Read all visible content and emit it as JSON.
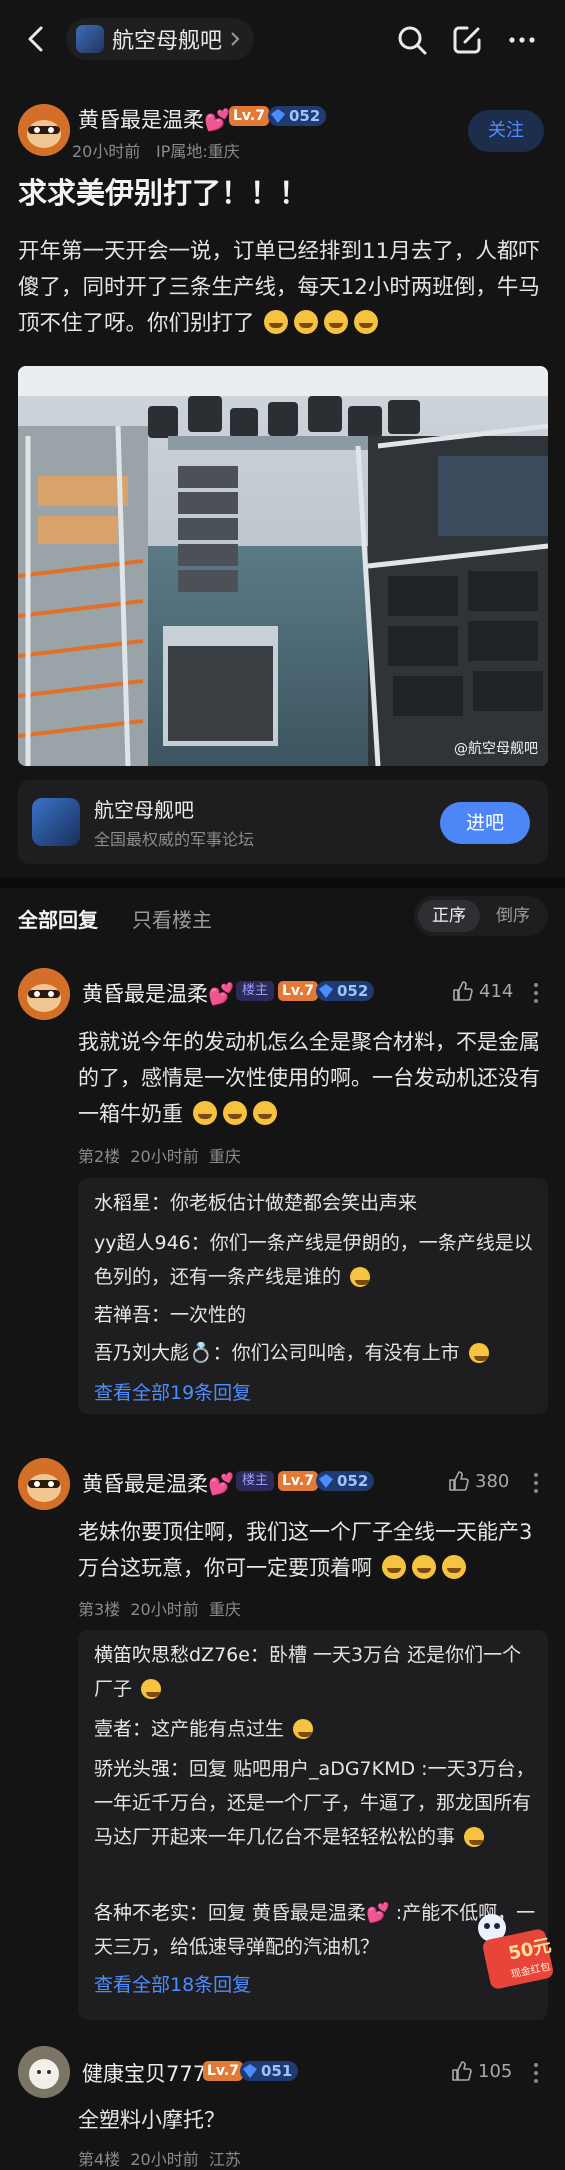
{
  "topbar": {
    "forum_name": "航空母舰吧"
  },
  "post": {
    "author": "黄昏最是温柔",
    "heart": "💕",
    "level": "Lv.7",
    "gem_level": "052",
    "time": "20小时前",
    "ip": "IP属地:重庆",
    "follow_label": "关注",
    "title": "求求美伊别打了！！！",
    "body": "开年第一天开会一说，订单已经排到11月去了，人都吓傻了，同时开了三条生产线，每天12小时两班倒，牛马顶不住了呀。你们别打了",
    "body_emoji_count": 4,
    "photo_watermark": "@航空母舰吧"
  },
  "forum_card": {
    "name": "航空母舰吧",
    "subtitle": "全国最权威的军事论坛",
    "join_label": "进吧"
  },
  "tabs": {
    "all_replies": "全部回复",
    "op_only": "只看楼主",
    "sort_asc": "正序",
    "sort_desc": "倒序"
  },
  "comments": [
    {
      "author": "黄昏最是温柔",
      "heart": "💕",
      "host_badge": "楼主",
      "level": "Lv.7",
      "gem_level": "052",
      "likes": "414",
      "text": "我就说今年的发动机怎么全是聚合材料，不是金属的了，感情是一次性使用的啊。一台发动机还没有一箱牛奶重",
      "floor": "第2楼",
      "time": "20小时前",
      "location": "重庆",
      "replies": [
        {
          "who": "水稻星：",
          "text": "你老板估计做楚都会笑出声来"
        },
        {
          "who": "yy超人946：",
          "text": "你们一条产线是伊朗的，一条产线是以色列的，还有一条产线是谁的"
        },
        {
          "who": "若禅吾：",
          "text": "一次性的"
        },
        {
          "who": "吾乃刘大彪💍：",
          "text": "你们公司叫啥，有没有上市"
        }
      ],
      "view_all": "查看全部19条回复"
    },
    {
      "author": "黄昏最是温柔",
      "heart": "💕",
      "host_badge": "楼主",
      "level": "Lv.7",
      "gem_level": "052",
      "likes": "380",
      "text": "老妹你要顶住啊，我们这一个厂子全线一天能产3万台这玩意，你可一定要顶着啊",
      "floor": "第3楼",
      "time": "20小时前",
      "location": "重庆",
      "replies": [
        {
          "who": "横笛吹思愁dZ76e：",
          "text": "卧槽 一天3万台 还是你们一个厂子"
        },
        {
          "who": "壹者：",
          "text": "这产能有点过生"
        },
        {
          "who": "骄光头强：",
          "text": "回复 贴吧用户_aDG7KMD :一天3万台，一年近千万台，还是一个厂子，牛逼了，那龙国所有马达厂开起来一年几亿台不是轻轻松松的事"
        },
        {
          "who": "各种不老实：",
          "text": "回复 黄昏最是温柔💕 :产能不低啊，一天三万，给低速导弹配的汽油机？"
        }
      ],
      "view_all": "查看全部18条回复",
      "sticker_text": "50元 现金红包"
    },
    {
      "author": "健康宝贝777",
      "level": "Lv.7",
      "gem_level": "051",
      "likes": "105",
      "text": "全塑料小摩托？",
      "floor": "第4楼",
      "time": "20小时前",
      "location": "江苏"
    }
  ]
}
